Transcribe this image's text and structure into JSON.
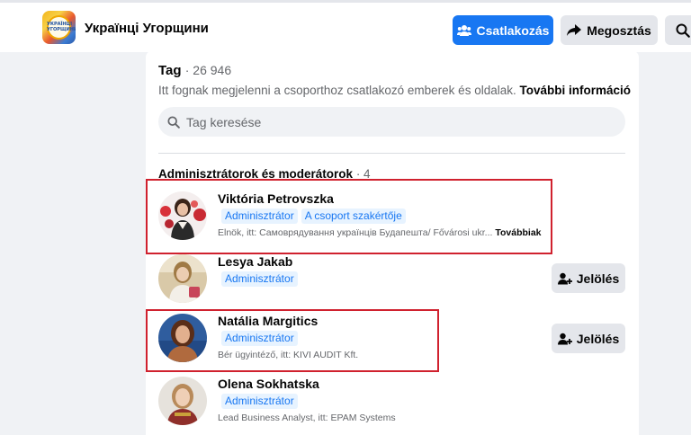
{
  "header": {
    "group_name": "Українці Угорщини",
    "logo_text": "УКРАЇНЦІ УГОРЩИНИ",
    "join_label": "Csatlakozás",
    "share_label": "Megosztás"
  },
  "members": {
    "title": "Tag",
    "count": "· 26 946",
    "subtitle": "Itt fognak megjelenni a csoporthoz csatlakozó emberek és oldalak.",
    "more_info": "További információ",
    "search_placeholder": "Tag keresése",
    "admins_heading": "Adminisztrátorok és moderátorok",
    "admins_count": "· 4",
    "list": [
      {
        "name": "Viktória Petrovszka",
        "badges": [
          "Adminisztrátor",
          "A csoport szakértője"
        ],
        "desc": "Elnök, itt: Самоврядування українців Будапешта/ Fővárosi ukr...",
        "more": "Továbbiak"
      },
      {
        "name": "Lesya Jakab",
        "badges": [
          "Adminisztrátor"
        ],
        "nominate": "Jelölés"
      },
      {
        "name": "Natália Margitics",
        "badges": [
          "Adminisztrátor"
        ],
        "desc": "Bér ügyintéző, itt: KIVI AUDIT Kft.",
        "nominate": "Jelölés"
      },
      {
        "name": "Olena Sokhatska",
        "badges": [
          "Adminisztrátor"
        ],
        "desc": "Lead Business Analyst, itt: EPAM Systems"
      }
    ]
  },
  "colors": {
    "accent": "#1877f2",
    "highlight": "#d0212e",
    "background": "#f0f2f5"
  }
}
